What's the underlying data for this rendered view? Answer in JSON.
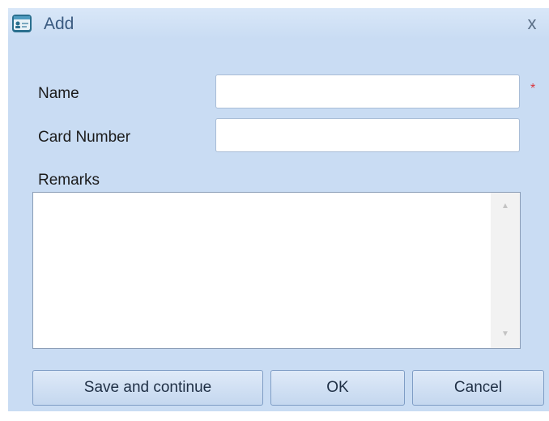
{
  "window": {
    "title": "Add",
    "close_glyph": "x"
  },
  "form": {
    "name_label": "Name",
    "name_value": "",
    "required_marker": "*",
    "card_label": "Card Number",
    "card_value": "",
    "remarks_label": "Remarks",
    "remarks_value": ""
  },
  "buttons": {
    "save_continue": "Save and continue",
    "ok": "OK",
    "cancel": "Cancel"
  },
  "icons": {
    "app": "id-card-icon",
    "close": "close-icon",
    "scroll_up": "chevron-up-icon",
    "scroll_down": "chevron-down-icon"
  },
  "colors": {
    "dialog_bg": "#c9dcf3",
    "required": "#d9363e",
    "button_border": "#7f9dc5"
  }
}
